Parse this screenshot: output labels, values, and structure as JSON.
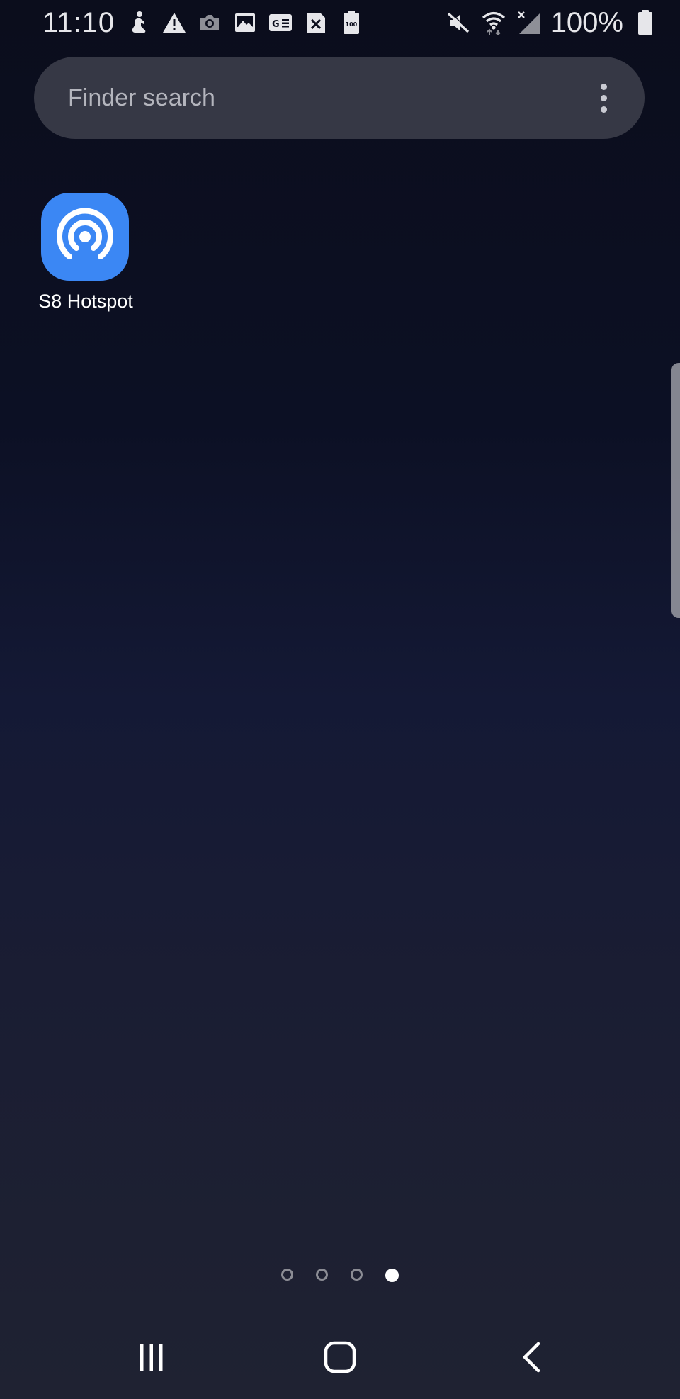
{
  "status_bar": {
    "time": "11:10",
    "battery_percent": "100%",
    "left_icons": [
      "hand-person-icon",
      "warning-icon",
      "camera-icon",
      "image-icon",
      "ge-icon",
      "close-box-icon",
      "battery-100-icon"
    ],
    "right_icons": [
      "mute-icon",
      "wifi-icon",
      "signal-icon",
      "battery-icon"
    ]
  },
  "search": {
    "placeholder": "Finder search",
    "more_icon": "more-vert-icon"
  },
  "apps": [
    {
      "label": "S8 Hotspot",
      "icon": "hotspot-icon",
      "icon_color": "#3b87f4"
    }
  ],
  "page_indicator": {
    "count": 4,
    "active_index": 3
  },
  "navigation": {
    "recents_icon": "recents-icon",
    "home_icon": "home-icon",
    "back_icon": "back-icon"
  },
  "colors": {
    "accent": "#3b87f4",
    "search_bar": "#363845"
  }
}
